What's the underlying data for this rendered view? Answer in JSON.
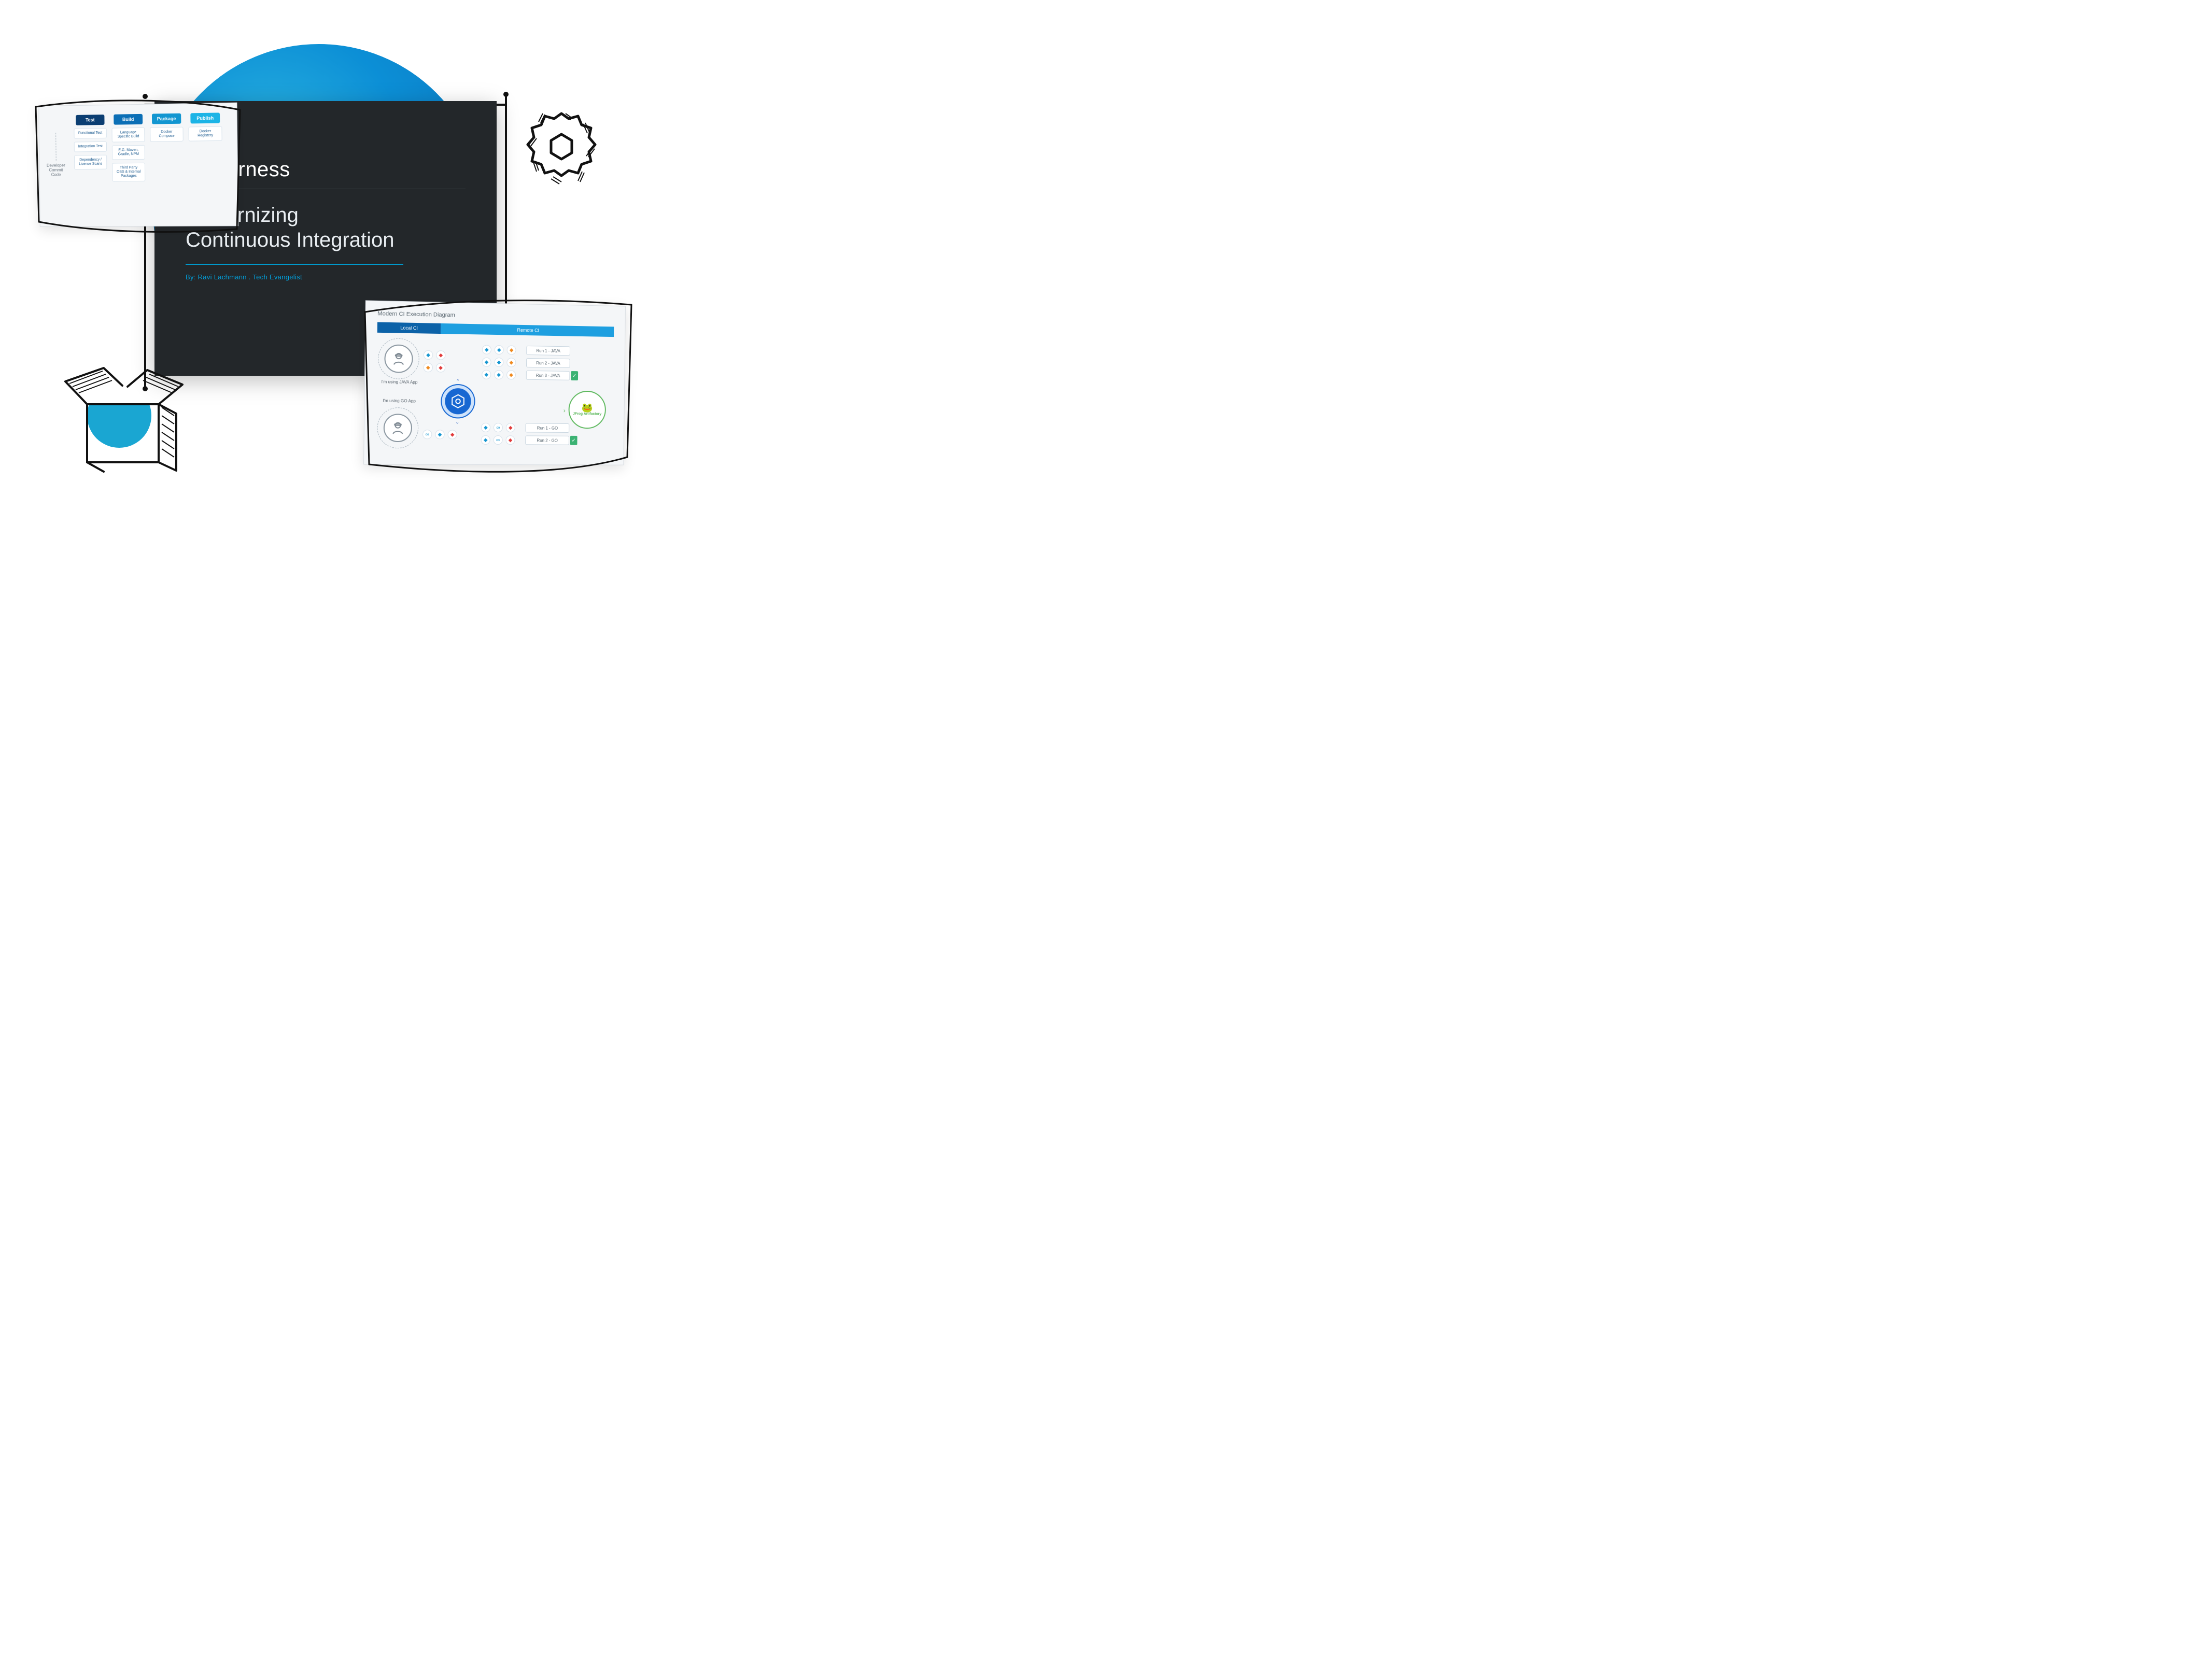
{
  "brand": {
    "name": "harness"
  },
  "main": {
    "title_line1": "Modernizing",
    "title_line2": "Continuous Integration",
    "byline": "By: Ravi Lachmann . Tech Evangelist"
  },
  "pipeline_card": {
    "origin_label": "Developer Commit Code",
    "stages": [
      {
        "name": "Test",
        "class": "chip-test",
        "steps": [
          "Functional Test",
          "Integration Test",
          "Dependency / License Scans"
        ]
      },
      {
        "name": "Build",
        "class": "chip-build",
        "steps": [
          "Language Specific Build",
          "E.G. Maven, Gradle, NPM",
          "Third Party OSS & Internal Packages"
        ]
      },
      {
        "name": "Package",
        "class": "chip-pack",
        "steps": [
          "Docker Compose"
        ]
      },
      {
        "name": "Publish",
        "class": "chip-pub",
        "steps": [
          "Docker Registery"
        ]
      }
    ]
  },
  "exec_card": {
    "title": "Modern CI Execution Diagram",
    "tabs": {
      "local": "Local CI",
      "remote": "Remote CI"
    },
    "users": [
      {
        "label": "I'm using JAVA App"
      },
      {
        "label": "I'm using GO App"
      }
    ],
    "runs_java": [
      "Run 1 - JAVA",
      "Run 2 - JAVA",
      "Run 3 - JAVA"
    ],
    "runs_go": [
      "Run 1 - GO",
      "Run 2 - GO"
    ],
    "artifact_label": "JFrog Artifactory"
  }
}
